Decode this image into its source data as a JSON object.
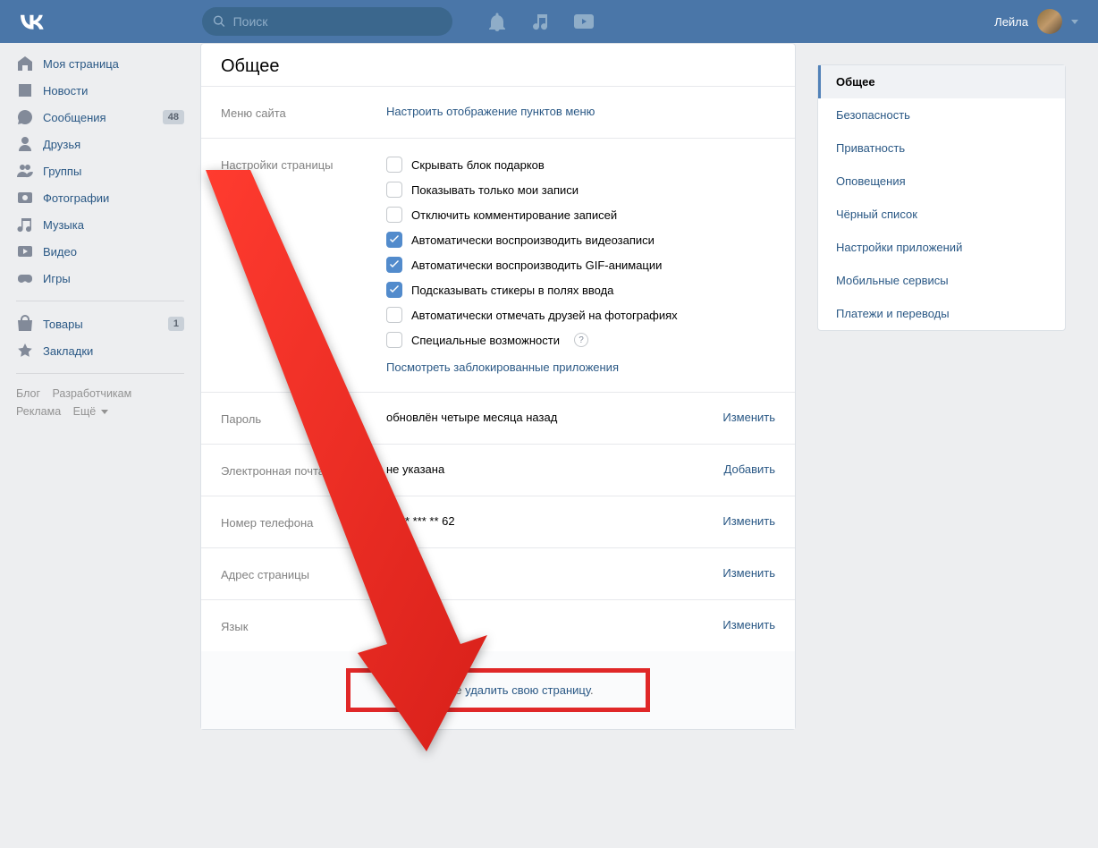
{
  "header": {
    "search_placeholder": "Поиск",
    "username": "Лейла"
  },
  "sidebar": {
    "items": [
      {
        "label": "Моя страница",
        "icon": "home"
      },
      {
        "label": "Новости",
        "icon": "news"
      },
      {
        "label": "Сообщения",
        "icon": "msg",
        "badge": "48"
      },
      {
        "label": "Друзья",
        "icon": "friends"
      },
      {
        "label": "Группы",
        "icon": "groups"
      },
      {
        "label": "Фотографии",
        "icon": "photos"
      },
      {
        "label": "Музыка",
        "icon": "music"
      },
      {
        "label": "Видео",
        "icon": "video"
      },
      {
        "label": "Игры",
        "icon": "games"
      }
    ],
    "items2": [
      {
        "label": "Товары",
        "icon": "market",
        "badge": "1"
      },
      {
        "label": "Закладки",
        "icon": "bookmark"
      }
    ],
    "footer": {
      "blog": "Блог",
      "dev": "Разработчикам",
      "ads": "Реклама",
      "more": "Ещё"
    }
  },
  "main": {
    "title": "Общее",
    "menu_label": "Меню сайта",
    "menu_link": "Настроить отображение пунктов меню",
    "page_settings_label": "Настройки страницы",
    "checks": [
      {
        "label": "Скрывать блок подарков",
        "on": false
      },
      {
        "label": "Показывать только мои записи",
        "on": false
      },
      {
        "label": "Отключить комментирование записей",
        "on": false
      },
      {
        "label": "Автоматически воспроизводить видеозаписи",
        "on": true
      },
      {
        "label": "Автоматически воспроизводить GIF-анимации",
        "on": true
      },
      {
        "label": "Подсказывать стикеры в полях ввода",
        "on": true
      },
      {
        "label": "Автоматически отмечать друзей на фотографиях",
        "on": false
      },
      {
        "label": "Специальные возможности",
        "on": false,
        "help": true
      }
    ],
    "blocked_link": "Посмотреть заблокированные приложения",
    "rows": [
      {
        "label": "Пароль",
        "value": "обновлён четыре месяца назад",
        "action": "Изменить"
      },
      {
        "label": "Электронная почта",
        "value": "не указана",
        "action": "Добавить"
      },
      {
        "label": "Номер телефона",
        "value": "7 *** *** ** 62",
        "action": "Изменить"
      },
      {
        "label": "Адрес страницы",
        "value": "h           .com",
        "action": "Изменить"
      },
      {
        "label": "Язык",
        "value": "Русский",
        "action": "Изменить"
      }
    ],
    "delete_prefix": "Вы можете ",
    "delete_link": "удалить свою страницу",
    "delete_suffix": "."
  },
  "right": {
    "items": [
      {
        "label": "Общее",
        "active": true
      },
      {
        "label": "Безопасность"
      },
      {
        "label": "Приватность"
      },
      {
        "label": "Оповещения"
      },
      {
        "label": "Чёрный список"
      },
      {
        "label": "Настройки приложений"
      },
      {
        "label": "Мобильные сервисы"
      },
      {
        "label": "Платежи и переводы"
      }
    ]
  }
}
